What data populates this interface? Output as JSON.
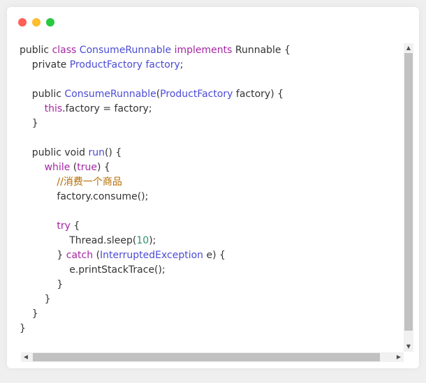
{
  "window": {
    "dots": [
      {
        "name": "close",
        "color": "#fe5f57"
      },
      {
        "name": "minimize",
        "color": "#febc2e"
      },
      {
        "name": "maximize",
        "color": "#28c840"
      }
    ]
  },
  "code": {
    "lines": [
      [
        [
          "pl",
          "public "
        ],
        [
          "kw",
          "class "
        ],
        [
          "ty",
          "ConsumeRunnable "
        ],
        [
          "kw",
          "implements "
        ],
        [
          "pl",
          "Runnable {"
        ]
      ],
      [
        [
          "pl",
          "    private "
        ],
        [
          "ty",
          "ProductFactory factory"
        ],
        [
          "pl",
          ";"
        ]
      ],
      [],
      [
        [
          "pl",
          "    public "
        ],
        [
          "ty",
          "ConsumeRunnable"
        ],
        [
          "pl",
          "("
        ],
        [
          "ty",
          "ProductFactory"
        ],
        [
          "pl",
          " factory) {"
        ]
      ],
      [
        [
          "pl",
          "        "
        ],
        [
          "kw",
          "this"
        ],
        [
          "pl",
          ".factory = factory;"
        ]
      ],
      [
        [
          "pl",
          "    }"
        ]
      ],
      [],
      [
        [
          "pl",
          "    public void "
        ],
        [
          "ty",
          "run"
        ],
        [
          "pl",
          "() {"
        ]
      ],
      [
        [
          "pl",
          "        "
        ],
        [
          "kw",
          "while "
        ],
        [
          "pl",
          "("
        ],
        [
          "kw",
          "true"
        ],
        [
          "pl",
          ") {"
        ]
      ],
      [
        [
          "pl",
          "            "
        ],
        [
          "cm",
          "//消费一个商品"
        ]
      ],
      [
        [
          "pl",
          "            factory.consume();"
        ]
      ],
      [],
      [
        [
          "pl",
          "            "
        ],
        [
          "kw",
          "try"
        ],
        [
          "pl",
          " {"
        ]
      ],
      [
        [
          "pl",
          "                Thread.sleep("
        ],
        [
          "nu",
          "10"
        ],
        [
          "pl",
          ");"
        ]
      ],
      [
        [
          "pl",
          "            } "
        ],
        [
          "kw",
          "catch "
        ],
        [
          "pl",
          "("
        ],
        [
          "ty",
          "InterruptedException"
        ],
        [
          "pl",
          " e) {"
        ]
      ],
      [
        [
          "pl",
          "                e.printStackTrace();"
        ]
      ],
      [
        [
          "pl",
          "            }"
        ]
      ],
      [
        [
          "pl",
          "        }"
        ]
      ],
      [
        [
          "pl",
          "    }"
        ]
      ],
      [
        [
          "pl",
          "}"
        ]
      ]
    ]
  },
  "scrollbars": {
    "up_arrow": "▲",
    "down_arrow": "▼",
    "left_arrow": "◀",
    "right_arrow": "▶"
  }
}
